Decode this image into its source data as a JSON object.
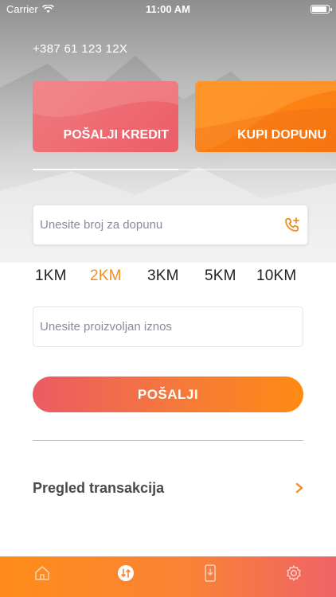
{
  "status_bar": {
    "carrier": "Carrier",
    "time": "11:00 AM"
  },
  "account": {
    "phone_number": "+387 61 123 12X"
  },
  "action_cards": {
    "send_credit_label": "POŠALJI KREDIT",
    "buy_topup_label": "KUPI DOPUNU",
    "send_color": "#ec5d68",
    "buy_color": "#ff8c1a"
  },
  "form": {
    "phone_input": {
      "placeholder": "Unesite broj za dopunu",
      "value": "",
      "icon": "add-contact-phone-icon"
    },
    "amount_options": [
      "1KM",
      "2KM",
      "3KM",
      "5KM",
      "10KM"
    ],
    "selected_amount": "2KM",
    "custom_amount_input": {
      "placeholder": "Unesite proizvoljan iznos",
      "value": ""
    },
    "send_button_label": "POŠALJI"
  },
  "transactions": {
    "label": "Pregled transakcija",
    "icon": "chevron-right-icon"
  },
  "tab_bar": {
    "items": [
      {
        "icon": "home-icon",
        "active": false
      },
      {
        "icon": "transfer-icon",
        "active": true
      },
      {
        "icon": "mobile-topup-icon",
        "active": false
      },
      {
        "icon": "settings-gear-icon",
        "active": false
      }
    ]
  },
  "colors": {
    "accent_orange": "#f48d1c",
    "accent_red": "#ec5a63",
    "text_dark": "#4a4a4a"
  }
}
